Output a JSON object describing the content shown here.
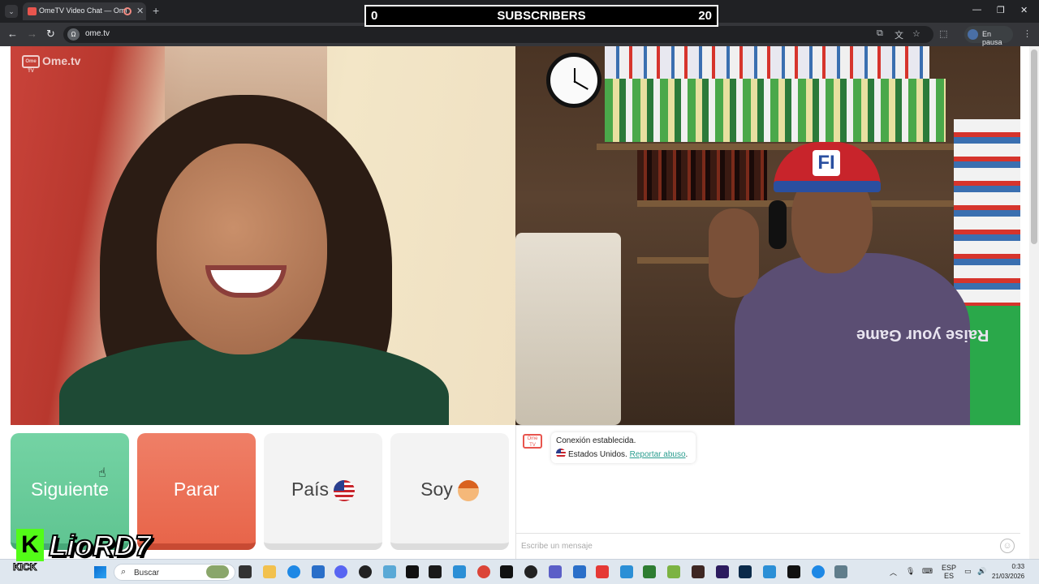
{
  "browser": {
    "tab_title": "OmeTV Video Chat — Ome",
    "url": "ome.tv",
    "site_icon": "OmeTV",
    "profile_status": "En pausa"
  },
  "overlay": {
    "left": "0",
    "label": "SUBSCRIBERS",
    "right": "20"
  },
  "video": {
    "watermark": "Ome.tv",
    "watermark_box": "Ome TV",
    "cap_logo": "FI",
    "shirt_text": "Raise your Game"
  },
  "controls": {
    "next": "Siguiente",
    "stop": "Parar",
    "country": "País",
    "gender": "Soy"
  },
  "chat": {
    "avatar": "Ome TV",
    "line1": "Conexión establecida.",
    "country": "Estados Unidos.",
    "report_link": "Reportar abuso",
    "report_suffix": ".",
    "input_placeholder": "Escribe un mensaje"
  },
  "streamer": {
    "kick_letter": "K",
    "name": "LioRD7",
    "sub": "KICK"
  },
  "taskbar": {
    "search_placeholder": "Buscar",
    "lang_top": "ESP",
    "lang_bottom": "ES",
    "time": "0:33",
    "date": "21/03/2026"
  },
  "colors": {
    "next_green": "#60c592",
    "stop_red": "#e8654a",
    "kick_green": "#53fc18"
  }
}
